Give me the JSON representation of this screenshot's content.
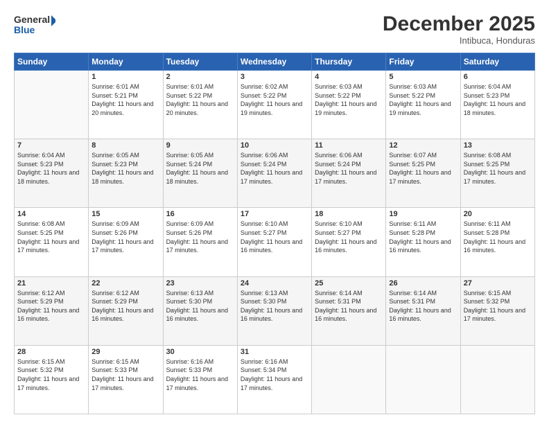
{
  "header": {
    "logo_line1": "General",
    "logo_line2": "Blue",
    "month": "December 2025",
    "location": "Intibuca, Honduras"
  },
  "weekdays": [
    "Sunday",
    "Monday",
    "Tuesday",
    "Wednesday",
    "Thursday",
    "Friday",
    "Saturday"
  ],
  "weeks": [
    [
      {
        "day": "",
        "sunrise": "",
        "sunset": "",
        "daylight": ""
      },
      {
        "day": "1",
        "sunrise": "Sunrise: 6:01 AM",
        "sunset": "Sunset: 5:21 PM",
        "daylight": "Daylight: 11 hours and 20 minutes."
      },
      {
        "day": "2",
        "sunrise": "Sunrise: 6:01 AM",
        "sunset": "Sunset: 5:22 PM",
        "daylight": "Daylight: 11 hours and 20 minutes."
      },
      {
        "day": "3",
        "sunrise": "Sunrise: 6:02 AM",
        "sunset": "Sunset: 5:22 PM",
        "daylight": "Daylight: 11 hours and 19 minutes."
      },
      {
        "day": "4",
        "sunrise": "Sunrise: 6:03 AM",
        "sunset": "Sunset: 5:22 PM",
        "daylight": "Daylight: 11 hours and 19 minutes."
      },
      {
        "day": "5",
        "sunrise": "Sunrise: 6:03 AM",
        "sunset": "Sunset: 5:22 PM",
        "daylight": "Daylight: 11 hours and 19 minutes."
      },
      {
        "day": "6",
        "sunrise": "Sunrise: 6:04 AM",
        "sunset": "Sunset: 5:23 PM",
        "daylight": "Daylight: 11 hours and 18 minutes."
      }
    ],
    [
      {
        "day": "7",
        "sunrise": "Sunrise: 6:04 AM",
        "sunset": "Sunset: 5:23 PM",
        "daylight": "Daylight: 11 hours and 18 minutes."
      },
      {
        "day": "8",
        "sunrise": "Sunrise: 6:05 AM",
        "sunset": "Sunset: 5:23 PM",
        "daylight": "Daylight: 11 hours and 18 minutes."
      },
      {
        "day": "9",
        "sunrise": "Sunrise: 6:05 AM",
        "sunset": "Sunset: 5:24 PM",
        "daylight": "Daylight: 11 hours and 18 minutes."
      },
      {
        "day": "10",
        "sunrise": "Sunrise: 6:06 AM",
        "sunset": "Sunset: 5:24 PM",
        "daylight": "Daylight: 11 hours and 17 minutes."
      },
      {
        "day": "11",
        "sunrise": "Sunrise: 6:06 AM",
        "sunset": "Sunset: 5:24 PM",
        "daylight": "Daylight: 11 hours and 17 minutes."
      },
      {
        "day": "12",
        "sunrise": "Sunrise: 6:07 AM",
        "sunset": "Sunset: 5:25 PM",
        "daylight": "Daylight: 11 hours and 17 minutes."
      },
      {
        "day": "13",
        "sunrise": "Sunrise: 6:08 AM",
        "sunset": "Sunset: 5:25 PM",
        "daylight": "Daylight: 11 hours and 17 minutes."
      }
    ],
    [
      {
        "day": "14",
        "sunrise": "Sunrise: 6:08 AM",
        "sunset": "Sunset: 5:25 PM",
        "daylight": "Daylight: 11 hours and 17 minutes."
      },
      {
        "day": "15",
        "sunrise": "Sunrise: 6:09 AM",
        "sunset": "Sunset: 5:26 PM",
        "daylight": "Daylight: 11 hours and 17 minutes."
      },
      {
        "day": "16",
        "sunrise": "Sunrise: 6:09 AM",
        "sunset": "Sunset: 5:26 PM",
        "daylight": "Daylight: 11 hours and 17 minutes."
      },
      {
        "day": "17",
        "sunrise": "Sunrise: 6:10 AM",
        "sunset": "Sunset: 5:27 PM",
        "daylight": "Daylight: 11 hours and 16 minutes."
      },
      {
        "day": "18",
        "sunrise": "Sunrise: 6:10 AM",
        "sunset": "Sunset: 5:27 PM",
        "daylight": "Daylight: 11 hours and 16 minutes."
      },
      {
        "day": "19",
        "sunrise": "Sunrise: 6:11 AM",
        "sunset": "Sunset: 5:28 PM",
        "daylight": "Daylight: 11 hours and 16 minutes."
      },
      {
        "day": "20",
        "sunrise": "Sunrise: 6:11 AM",
        "sunset": "Sunset: 5:28 PM",
        "daylight": "Daylight: 11 hours and 16 minutes."
      }
    ],
    [
      {
        "day": "21",
        "sunrise": "Sunrise: 6:12 AM",
        "sunset": "Sunset: 5:29 PM",
        "daylight": "Daylight: 11 hours and 16 minutes."
      },
      {
        "day": "22",
        "sunrise": "Sunrise: 6:12 AM",
        "sunset": "Sunset: 5:29 PM",
        "daylight": "Daylight: 11 hours and 16 minutes."
      },
      {
        "day": "23",
        "sunrise": "Sunrise: 6:13 AM",
        "sunset": "Sunset: 5:30 PM",
        "daylight": "Daylight: 11 hours and 16 minutes."
      },
      {
        "day": "24",
        "sunrise": "Sunrise: 6:13 AM",
        "sunset": "Sunset: 5:30 PM",
        "daylight": "Daylight: 11 hours and 16 minutes."
      },
      {
        "day": "25",
        "sunrise": "Sunrise: 6:14 AM",
        "sunset": "Sunset: 5:31 PM",
        "daylight": "Daylight: 11 hours and 16 minutes."
      },
      {
        "day": "26",
        "sunrise": "Sunrise: 6:14 AM",
        "sunset": "Sunset: 5:31 PM",
        "daylight": "Daylight: 11 hours and 16 minutes."
      },
      {
        "day": "27",
        "sunrise": "Sunrise: 6:15 AM",
        "sunset": "Sunset: 5:32 PM",
        "daylight": "Daylight: 11 hours and 17 minutes."
      }
    ],
    [
      {
        "day": "28",
        "sunrise": "Sunrise: 6:15 AM",
        "sunset": "Sunset: 5:32 PM",
        "daylight": "Daylight: 11 hours and 17 minutes."
      },
      {
        "day": "29",
        "sunrise": "Sunrise: 6:15 AM",
        "sunset": "Sunset: 5:33 PM",
        "daylight": "Daylight: 11 hours and 17 minutes."
      },
      {
        "day": "30",
        "sunrise": "Sunrise: 6:16 AM",
        "sunset": "Sunset: 5:33 PM",
        "daylight": "Daylight: 11 hours and 17 minutes."
      },
      {
        "day": "31",
        "sunrise": "Sunrise: 6:16 AM",
        "sunset": "Sunset: 5:34 PM",
        "daylight": "Daylight: 11 hours and 17 minutes."
      },
      {
        "day": "",
        "sunrise": "",
        "sunset": "",
        "daylight": ""
      },
      {
        "day": "",
        "sunrise": "",
        "sunset": "",
        "daylight": ""
      },
      {
        "day": "",
        "sunrise": "",
        "sunset": "",
        "daylight": ""
      }
    ]
  ]
}
